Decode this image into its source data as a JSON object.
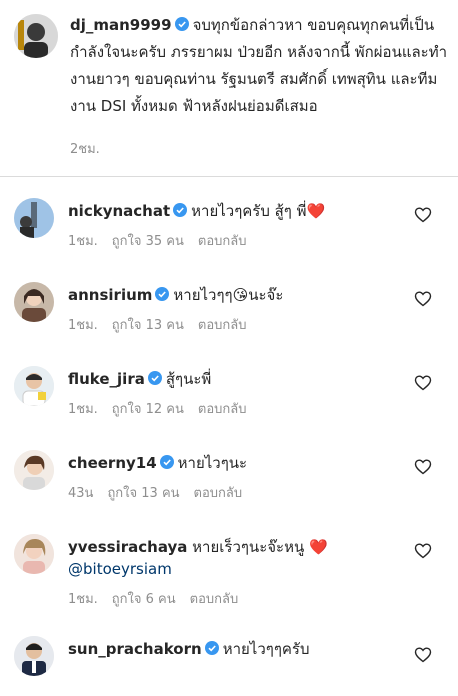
{
  "post": {
    "username": "dj_man9999",
    "caption": "จบทุกข้อกล่าวหา ขอบคุณทุกคนที่เป็น กำลังใจนะครับ ภรรยาผม ป่วยอีก หลังจากนี้ พักผ่อนและทำงานยาวๆ ขอบคุณท่าน รัฐมนตรี สมศักดิ์ เทพสุทิน และทีมงาน DSI ทั้งหมด ฟ้าหลังฝนย่อมดีเสมอ",
    "time": "2ชม."
  },
  "comments": [
    {
      "username": "nickynachat",
      "verified": true,
      "text": "หายไวๆครับ สู้ๆ พี่",
      "emoji": "❤️",
      "time": "1ชม.",
      "likes": "ถูกใจ 35 คน",
      "reply": "ตอบกลับ"
    },
    {
      "username": "annsirium",
      "verified": true,
      "text": "หายไวๆๆ",
      "emoji": "😘",
      "text2": "นะจ๊ะ",
      "time": "1ชม.",
      "likes": "ถูกใจ 13 คน",
      "reply": "ตอบกลับ"
    },
    {
      "username": "fluke_jira",
      "verified": true,
      "text": "สู้ๆนะพี่",
      "time": "1ชม.",
      "likes": "ถูกใจ 12 คน",
      "reply": "ตอบกลับ"
    },
    {
      "username": "cheerny14",
      "verified": true,
      "text": "หายไวๆนะ",
      "time": "43น",
      "likes": "ถูกใจ 13 คน",
      "reply": "ตอบกลับ"
    },
    {
      "username": "yvessirachaya",
      "verified": false,
      "text": "หายเร็วๆนะจ๊ะหนู",
      "emoji": "❤️",
      "mention": "@bitoeyrsiam",
      "time": "1ชม.",
      "likes": "ถูกใจ 6 คน",
      "reply": "ตอบกลับ"
    },
    {
      "username": "sun_prachakorn",
      "verified": true,
      "text": "หายไวๆๆครับ"
    }
  ],
  "icons": {
    "verified": "verified-badge-icon",
    "heart": "heart-outline-icon",
    "verified_color": "#3897f0",
    "heart_emoji_color": "#ed4956"
  }
}
